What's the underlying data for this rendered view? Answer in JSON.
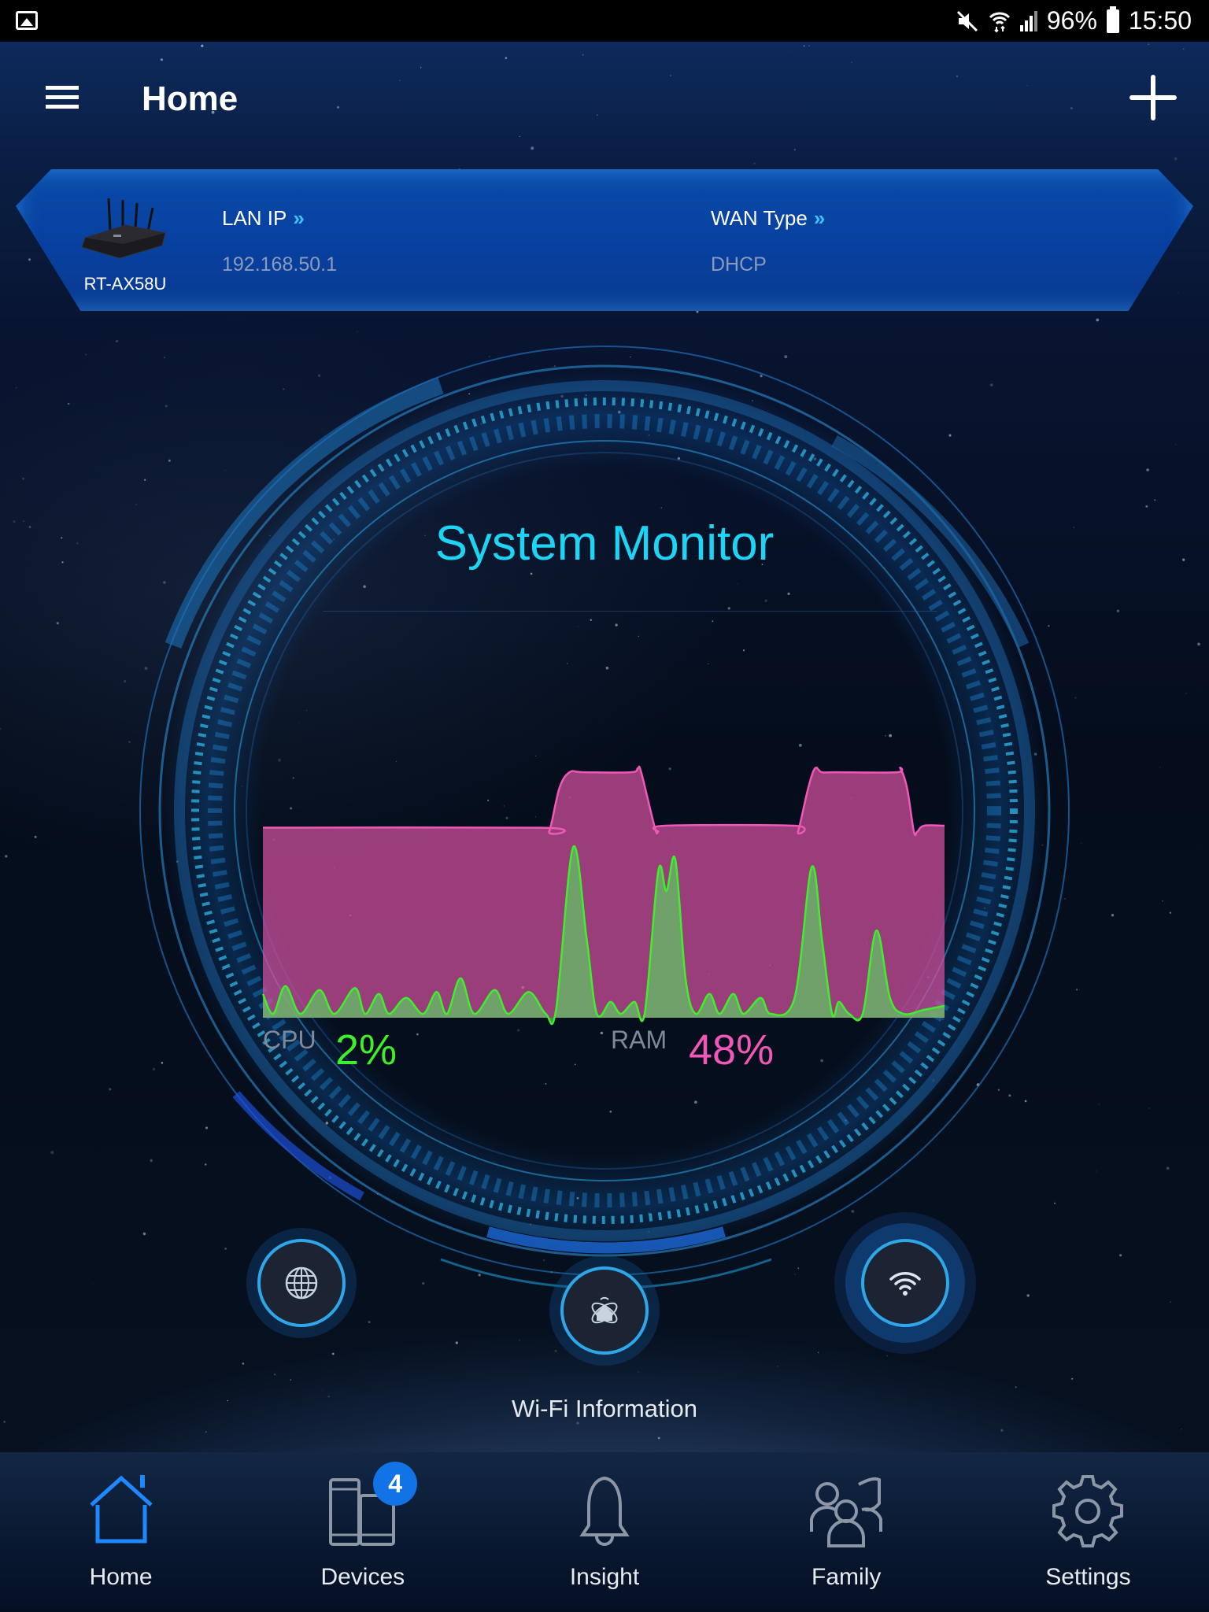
{
  "status_bar": {
    "battery_percent": "96%",
    "time": "15:50",
    "icons": [
      "gallery-icon",
      "mute-icon",
      "wifi-icon",
      "signal-icon",
      "battery-icon"
    ]
  },
  "header": {
    "title": "Home",
    "menu_icon": "hamburger-menu-icon",
    "add_icon": "plus-icon"
  },
  "router": {
    "model": "RT-AX58U",
    "lan_ip_label": "LAN IP",
    "lan_ip_value": "192.168.50.1",
    "wan_type_label": "WAN Type",
    "wan_type_value": "DHCP",
    "chevron": "»"
  },
  "system_monitor": {
    "title": "System Monitor",
    "cpu_label": "CPU",
    "cpu_value": "2%",
    "ram_label": "RAM",
    "ram_value": "48%",
    "colors": {
      "cpu": "#3ef029",
      "ram": "#f058b8",
      "title": "#1ed4f5"
    }
  },
  "chart_data": {
    "type": "area",
    "title": "System Monitor",
    "xlabel": "",
    "ylabel": "",
    "ylim": [
      0,
      100
    ],
    "grid": false,
    "legend": "bottom",
    "series": [
      {
        "name": "RAM",
        "color": "#f058b8",
        "points": [
          [
            0,
            48
          ],
          [
            0.41,
            48
          ],
          [
            0.42,
            47
          ],
          [
            0.435,
            58
          ],
          [
            0.45,
            62
          ],
          [
            0.47,
            62
          ],
          [
            0.54,
            62
          ],
          [
            0.55,
            63
          ],
          [
            0.555,
            62
          ],
          [
            0.575,
            48
          ],
          [
            0.58,
            47
          ],
          [
            0.59,
            48.5
          ],
          [
            0.78,
            48.5
          ],
          [
            0.785,
            47
          ],
          [
            0.8,
            58
          ],
          [
            0.81,
            63
          ],
          [
            0.82,
            62
          ],
          [
            0.84,
            62
          ],
          [
            0.93,
            62
          ],
          [
            0.935,
            63
          ],
          [
            0.945,
            58
          ],
          [
            0.955,
            47
          ],
          [
            0.96,
            47
          ],
          [
            0.97,
            48.5
          ],
          [
            1,
            48.5
          ]
        ]
      },
      {
        "name": "CPU",
        "color": "#3ef029",
        "points": [
          [
            0,
            6
          ],
          [
            0.015,
            1
          ],
          [
            0.033,
            8
          ],
          [
            0.055,
            1
          ],
          [
            0.083,
            7
          ],
          [
            0.105,
            1
          ],
          [
            0.135,
            7.5
          ],
          [
            0.15,
            1
          ],
          [
            0.17,
            6
          ],
          [
            0.185,
            1
          ],
          [
            0.21,
            5
          ],
          [
            0.235,
            1
          ],
          [
            0.255,
            6.5
          ],
          [
            0.27,
            1
          ],
          [
            0.29,
            10
          ],
          [
            0.31,
            1
          ],
          [
            0.34,
            7
          ],
          [
            0.36,
            1
          ],
          [
            0.39,
            6.5
          ],
          [
            0.415,
            1
          ],
          [
            0.43,
            2
          ],
          [
            0.455,
            43
          ],
          [
            0.475,
            20
          ],
          [
            0.49,
            1
          ],
          [
            0.51,
            4
          ],
          [
            0.525,
            1
          ],
          [
            0.545,
            4
          ],
          [
            0.56,
            1
          ],
          [
            0.58,
            37
          ],
          [
            0.592,
            32
          ],
          [
            0.605,
            40
          ],
          [
            0.62,
            10
          ],
          [
            0.635,
            1
          ],
          [
            0.655,
            6
          ],
          [
            0.67,
            1
          ],
          [
            0.69,
            6
          ],
          [
            0.705,
            1
          ],
          [
            0.73,
            5
          ],
          [
            0.745,
            1
          ],
          [
            0.78,
            5
          ],
          [
            0.805,
            38
          ],
          [
            0.82,
            20
          ],
          [
            0.835,
            1
          ],
          [
            0.845,
            4
          ],
          [
            0.86,
            1
          ],
          [
            0.88,
            1
          ],
          [
            0.9,
            22
          ],
          [
            0.92,
            5
          ],
          [
            0.94,
            1
          ],
          [
            0.97,
            2
          ],
          [
            1,
            3
          ]
        ]
      }
    ],
    "current": {
      "CPU": 2,
      "RAM": 48
    }
  },
  "quick_actions": [
    {
      "name": "internet-status",
      "icon": "globe-icon"
    },
    {
      "name": "smart-home",
      "icon": "smart-home-icon"
    },
    {
      "name": "wifi-information",
      "icon": "wifi-icon",
      "selected": true
    }
  ],
  "selected_action_label": "Wi-Fi Information",
  "bottom_nav": {
    "items": [
      {
        "label": "Home",
        "icon": "home-icon",
        "active": true
      },
      {
        "label": "Devices",
        "icon": "devices-icon",
        "badge": "4"
      },
      {
        "label": "Insight",
        "icon": "bell-icon"
      },
      {
        "label": "Family",
        "icon": "family-icon"
      },
      {
        "label": "Settings",
        "icon": "gear-icon"
      }
    ],
    "active_color": "#1e88ff",
    "inactive_color": "#8d96a4"
  }
}
